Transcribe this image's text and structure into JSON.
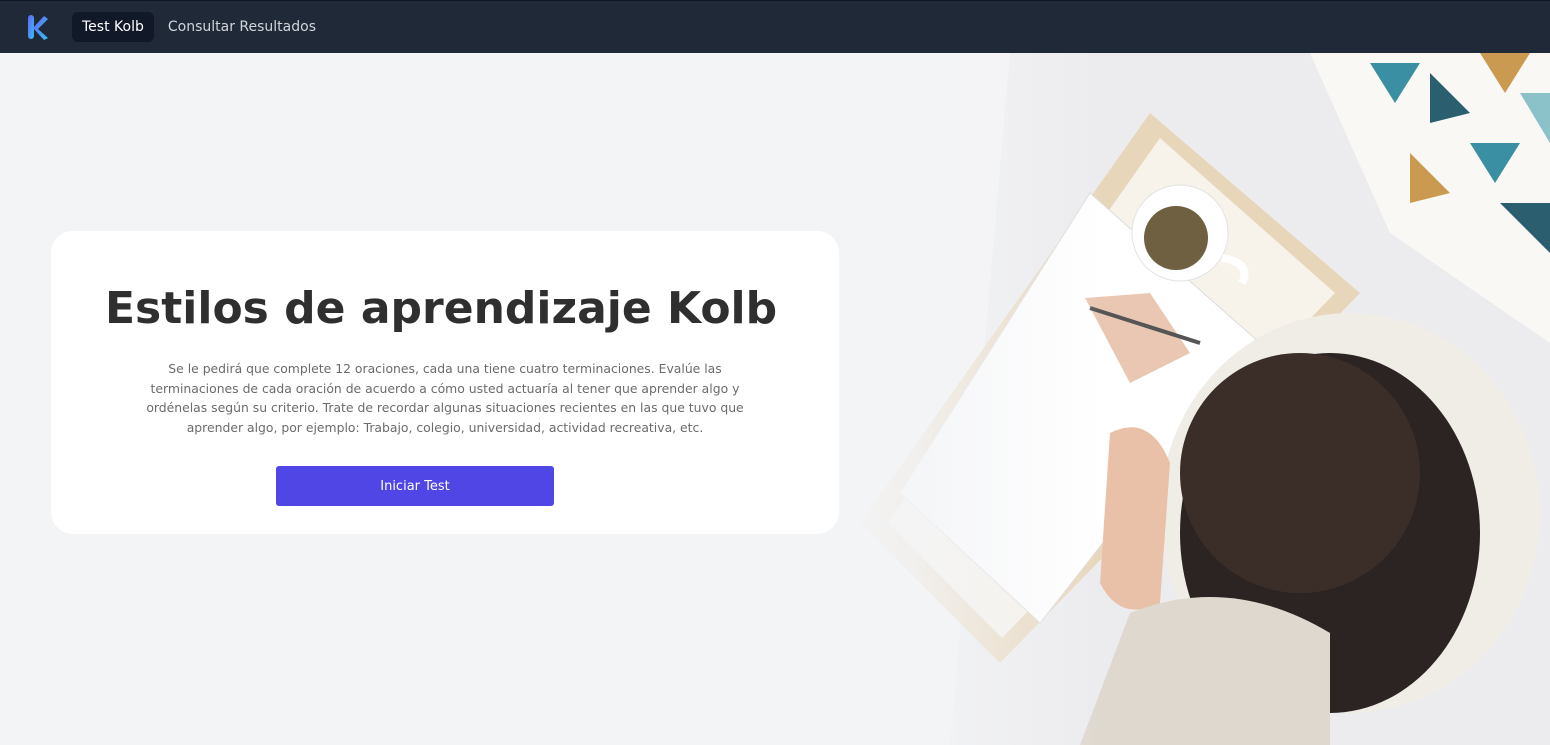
{
  "nav": {
    "logo_icon": "kolb-k-logo",
    "links": [
      {
        "label": "Test Kolb",
        "active": true
      },
      {
        "label": "Consultar Resultados",
        "active": false
      }
    ]
  },
  "hero": {
    "title": "Estilos de aprendizaje Kolb",
    "description": "Se le pedirá que complete 12 oraciones, cada una tiene cuatro terminaciones. Evalúe las terminaciones de cada oración de acuerdo a cómo usted actuaría al tener que aprender algo y ordénelas según su criterio. Trate de recordar algunas situaciones recientes en las que tuvo que aprender algo, por ejemplo: Trabajo, colegio, universidad, actividad recreativa, etc.",
    "button_label": "Iniciar Test",
    "image_subject": "woman-writing-on-bed-photo"
  },
  "colors": {
    "navbar": "#1f2937",
    "background": "#f3f4f6",
    "accent": "#4f46e5"
  }
}
